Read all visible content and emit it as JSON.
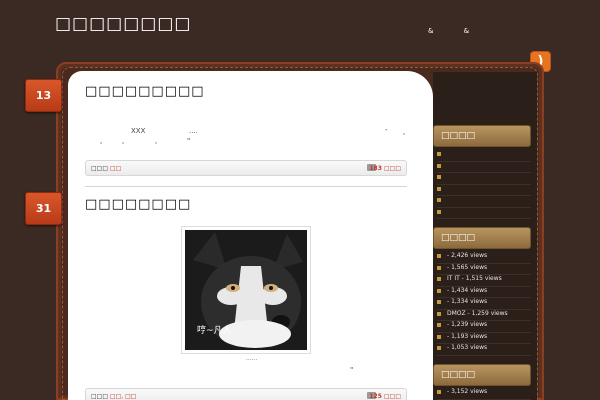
{
  "header": {
    "site_title": "□□□□□□□□",
    "tagline": "& &"
  },
  "icons": {
    "rss": "rss-icon"
  },
  "posts": [
    {
      "day": "13",
      "title": "□□□□□□□□□",
      "excerpt_fragments": [
        "XXX",
        "....",
        "-",
        ",",
        ",",
        ",",
        ",",
        "\""
      ],
      "meta_prefix": "□□□",
      "meta_category": "□□",
      "comment_count": "183 □□□"
    },
    {
      "day": "31",
      "title": "□□□□□□□□",
      "image_caption": "哼~凡人",
      "under_image_text": "......",
      "quote_mark": "\"",
      "meta_prefix": "□□□",
      "meta_category": "□□, □□",
      "comment_count": "125 □□□"
    }
  ],
  "sidebar": {
    "widgets": [
      {
        "title": "□□□□",
        "items": [
          "",
          "",
          "",
          "",
          "",
          ""
        ]
      },
      {
        "title": "□□□□",
        "items": [
          "- 2,426 views",
          "- 1,565 views",
          "IT IT - 1,515 views",
          "- 1,434 views",
          "- 1,334 views",
          "DMOZ - 1,259 views",
          "- 1,239 views",
          "- 1,193 views",
          "- 1,053 views"
        ]
      },
      {
        "title": "□□□□",
        "items": [
          "- 3,152 views"
        ]
      }
    ]
  },
  "colors": {
    "background": "#3a2a23",
    "accent_orange": "#d9572a",
    "sidebar_header": "#b8955f",
    "link_red": "#c0392b"
  }
}
